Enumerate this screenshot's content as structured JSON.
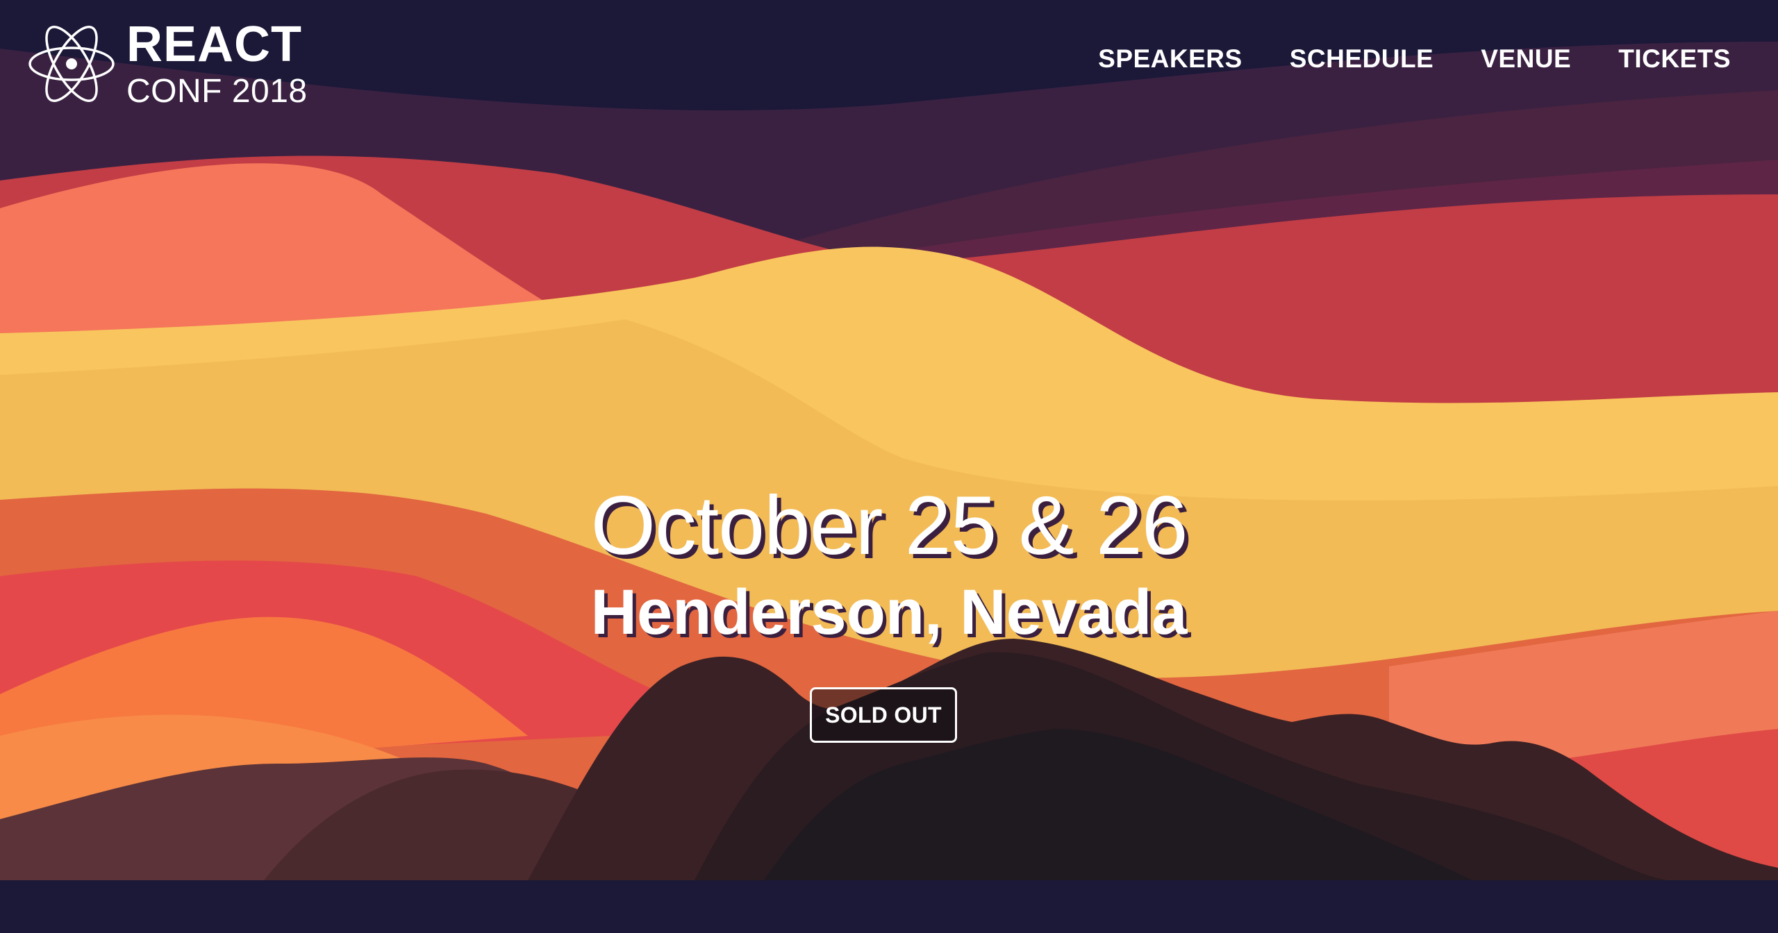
{
  "brand": {
    "title": "REACT",
    "subtitle": "CONF 2018",
    "logo_icon": "react-atom-icon"
  },
  "nav": {
    "items": [
      {
        "label": "SPEAKERS"
      },
      {
        "label": "SCHEDULE"
      },
      {
        "label": "VENUE"
      },
      {
        "label": "TICKETS"
      }
    ]
  },
  "hero": {
    "date": "October 25 & 26",
    "location": "Henderson, Nevada",
    "cta_label": "SOLD OUT"
  },
  "colors": {
    "background": "#1b1838",
    "accent_yellow": "#f8c45d",
    "accent_red": "#c23d45",
    "accent_orange": "#f67c4e",
    "mountain_dark": "#1f1a20"
  }
}
